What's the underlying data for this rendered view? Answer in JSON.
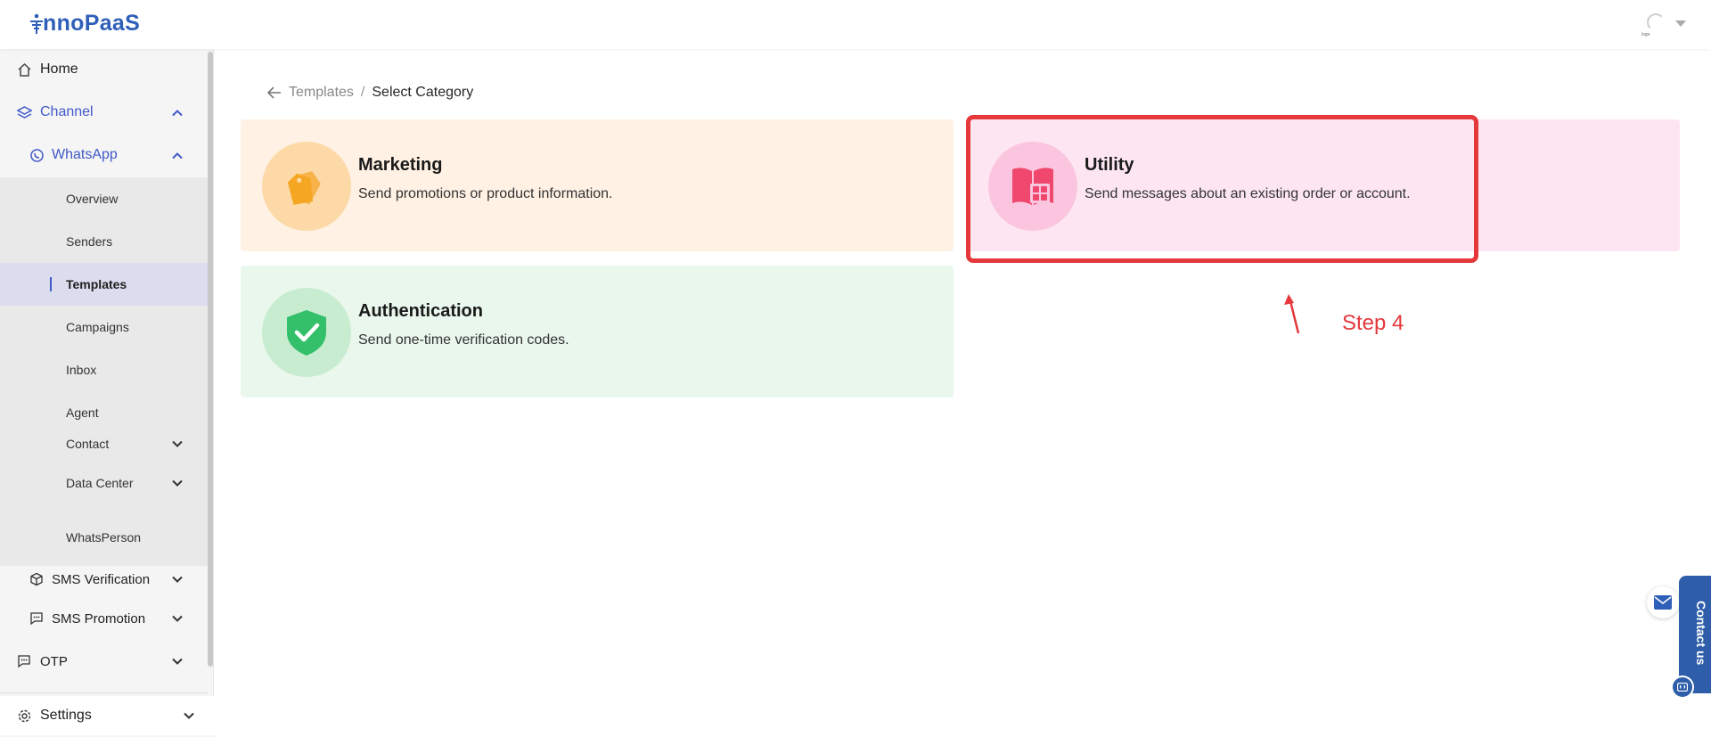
{
  "app": {
    "logo_text": "nnoPaaS"
  },
  "header": {
    "avatar_caption": "logo"
  },
  "sidebar": {
    "home": "Home",
    "channel": "Channel",
    "whatsapp": "WhatsApp",
    "whatsapp_items": [
      {
        "label": "Overview"
      },
      {
        "label": "Senders"
      },
      {
        "label": "Templates"
      },
      {
        "label": "Campaigns"
      },
      {
        "label": "Inbox"
      },
      {
        "label": "Agent"
      },
      {
        "label": "Contact"
      },
      {
        "label": "Data Center"
      },
      {
        "label": "WhatsPerson"
      }
    ],
    "active_item": "Templates",
    "sms_verification": "SMS Verification",
    "sms_promotion": "SMS Promotion",
    "otp": "OTP",
    "settings": "Settings"
  },
  "breadcrumb": {
    "parent": "Templates",
    "separator": "/",
    "current": "Select Category"
  },
  "categories": [
    {
      "title": "Marketing",
      "description": "Send promotions or product information.",
      "icon": "price-tag-icon",
      "color": "#f5a623"
    },
    {
      "title": "Utility",
      "description": "Send messages about an existing order or account.",
      "icon": "book-icon",
      "color": "#f0476e"
    },
    {
      "title": "Authentication",
      "description": "Send one-time verification codes.",
      "icon": "shield-check-icon",
      "color": "#34c06a"
    }
  ],
  "annotation": {
    "step_label": "Step 4",
    "color": "#e5383b"
  },
  "contact": {
    "label": "Contact us"
  },
  "colors": {
    "brand": "#2f5fb8",
    "active_nav": "#4059c8"
  }
}
